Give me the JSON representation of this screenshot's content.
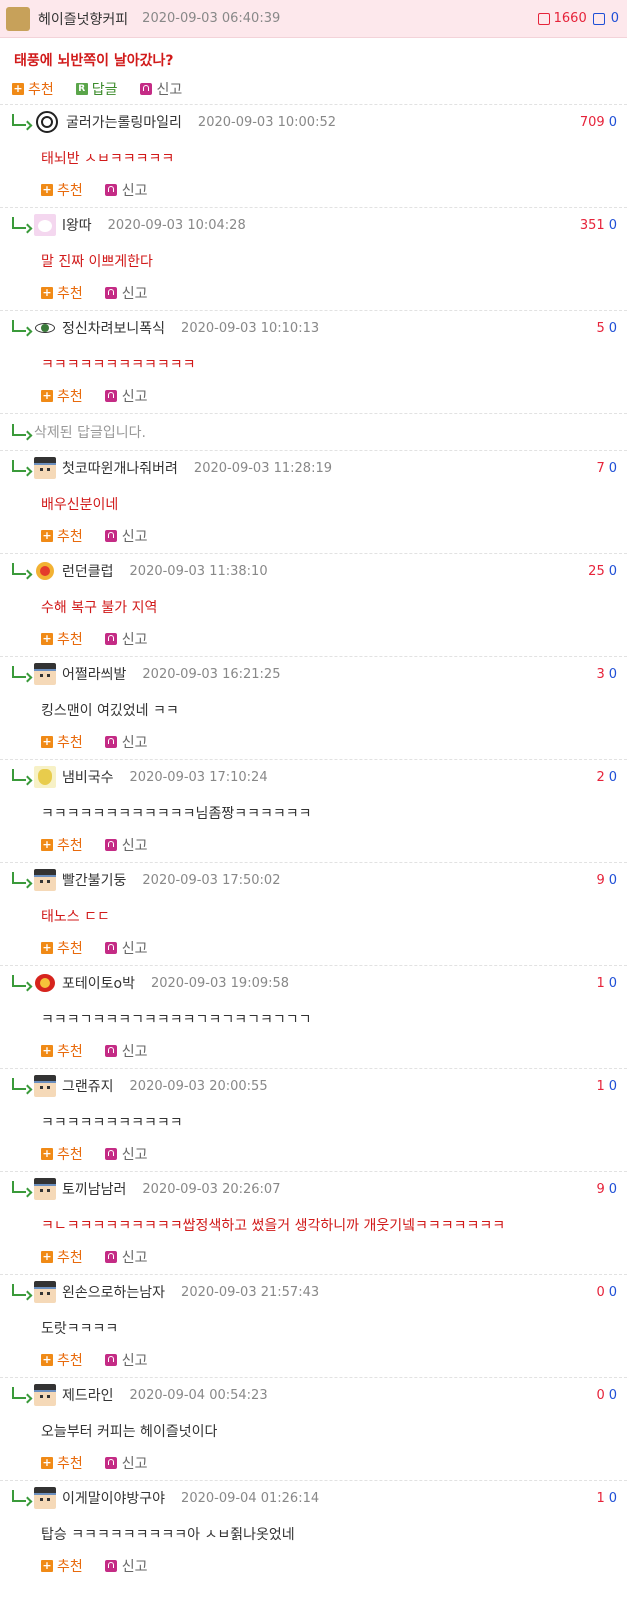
{
  "top_comment": {
    "nickname": "헤이즐넛향커피",
    "timestamp": "2020-09-03 06:40:39",
    "upvotes": "1660",
    "downvotes": "0",
    "text": "태풍에 뇌반쪽이 날아갔나?",
    "actions": {
      "recommend": "추천",
      "reply": "답글",
      "report": "신고"
    },
    "icons": {
      "reply_badge": "R"
    }
  },
  "colors": {
    "accent_red": "#d11a1a",
    "recommend_orange": "#e86a0c",
    "reply_green": "#3d8c2c",
    "down_blue": "#1f4fd6",
    "header_pink": "#fde8ec"
  },
  "reply_actions": {
    "recommend": "추천",
    "report": "신고"
  },
  "replies": [
    {
      "nickname": "굴러가는롤링마일리",
      "timestamp": "2020-09-03 10:00:52",
      "up": "709",
      "down": "0",
      "text": "태뇌반 ㅅㅂㅋㅋㅋㅋㅋ",
      "avatar": "spiral-avatar"
    },
    {
      "nickname": "l왕따",
      "timestamp": "2020-09-03 10:04:28",
      "up": "351",
      "down": "0",
      "text": "말 진짜 이쁘게한다",
      "avatar": "anime-avatar"
    },
    {
      "nickname": "정신차려보니폭식",
      "timestamp": "2020-09-03 10:10:13",
      "up": "5",
      "down": "0",
      "text": "ㅋㅋㅋㅋㅋㅋㅋㅋㅋㅋㅋㅋ",
      "avatar": "eye-avatar"
    },
    {
      "deleted_text": "삭제된 답글입니다."
    },
    {
      "nickname": "첫코따윈개나줘버려",
      "timestamp": "2020-09-03 11:28:19",
      "up": "7",
      "down": "0",
      "text": "배우신분이네",
      "avatar": "default-avatar"
    },
    {
      "nickname": "런던클럽",
      "timestamp": "2020-09-03 11:38:10",
      "up": "25",
      "down": "0",
      "text": "수해 복구 불가 지역",
      "avatar": "clown-avatar"
    },
    {
      "nickname": "어쩔라씌발",
      "timestamp": "2020-09-03 16:21:25",
      "up": "3",
      "down": "0",
      "text": "킹스맨이 여깄었네 ㅋㅋ",
      "avatar": "default-avatar"
    },
    {
      "nickname": "냄비국수",
      "timestamp": "2020-09-03 17:10:24",
      "up": "2",
      "down": "0",
      "text": "ㅋㅋㅋㅋㅋㅋㅋㅋㅋㅋㅋㅋ님좀짱ㅋㅋㅋㅋㅋㅋ",
      "avatar": "ramen-avatar"
    },
    {
      "nickname": "빨간불기둥",
      "timestamp": "2020-09-03 17:50:02",
      "up": "9",
      "down": "0",
      "text": "태노스 ㄷㄷ",
      "avatar": "default-avatar"
    },
    {
      "nickname": "포테이토o박",
      "timestamp": "2020-09-03 19:09:58",
      "up": "1",
      "down": "0",
      "text": "ㅋㅋㅋㄱㅋㅋㅋㄱㅋㅋㅋㅋㄱㅋㄱㅋㄱㅋㄱㄱㄱ",
      "avatar": "potato-avatar"
    },
    {
      "nickname": "그랜쥬지",
      "timestamp": "2020-09-03 20:00:55",
      "up": "1",
      "down": "0",
      "text": "ㅋㅋㅋㅋㅋㅋㅋㅋㅋㅋㅋ",
      "avatar": "default-avatar"
    },
    {
      "nickname": "토끼남남러",
      "timestamp": "2020-09-03 20:26:07",
      "up": "9",
      "down": "0",
      "text": "ㅋㄴㅋㅋㅋㅋㅋㅋㅋㅋㅋ쌉정색하고 썼을거 생각하니까 개웃기넼ㅋㅋㅋㅋㅋㅋㅋ",
      "avatar": "default-avatar"
    },
    {
      "nickname": "왼손으로하는남자",
      "timestamp": "2020-09-03 21:57:43",
      "up": "0",
      "down": "0",
      "text": "도랏ㅋㅋㅋㅋ",
      "avatar": "default-avatar"
    },
    {
      "nickname": "제드라인",
      "timestamp": "2020-09-04 00:54:23",
      "up": "0",
      "down": "0",
      "text": "오늘부터 커피는 헤이즐넛이다",
      "avatar": "default-avatar"
    },
    {
      "nickname": "이게말이야방구야",
      "timestamp": "2020-09-04 01:26:14",
      "up": "1",
      "down": "0",
      "text": "탑승 ㅋㅋㅋㅋㅋㅋㅋㅋㅋ아 ㅅㅂ쥙나옷었네",
      "avatar": "default-avatar"
    }
  ]
}
